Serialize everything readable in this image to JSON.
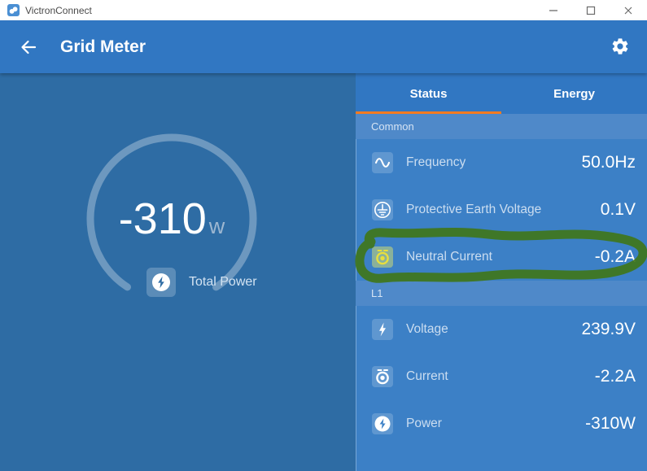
{
  "window": {
    "title": "VictronConnect",
    "controls": {
      "minimize": "minimize",
      "maximize": "maximize",
      "close": "close"
    }
  },
  "header": {
    "title": "Grid Meter"
  },
  "tabs": [
    {
      "label": "Status",
      "active": true
    },
    {
      "label": "Energy",
      "active": false
    }
  ],
  "gauge": {
    "value": "-310",
    "unit": "w",
    "label": "Total Power"
  },
  "sections": [
    {
      "title": "Common",
      "rows": [
        {
          "icon": "sine-wave-icon",
          "label": "Frequency",
          "value": "50.0Hz",
          "highlighted": false
        },
        {
          "icon": "protective-earth-icon",
          "label": "Protective Earth Voltage",
          "value": "0.1V",
          "highlighted": false
        },
        {
          "icon": "current-icon",
          "label": "Neutral Current",
          "value": "-0.2A",
          "highlighted": true
        }
      ]
    },
    {
      "title": "L1",
      "rows": [
        {
          "icon": "voltage-bolt-icon",
          "label": "Voltage",
          "value": "239.9V",
          "highlighted": false
        },
        {
          "icon": "current-icon",
          "label": "Current",
          "value": "-2.2A",
          "highlighted": false
        },
        {
          "icon": "power-bolt-icon",
          "label": "Power",
          "value": "-310W",
          "highlighted": false
        }
      ]
    }
  ],
  "annotation": {
    "type": "hand-drawn-marker-loop",
    "color": "#40761A",
    "target": "Neutral Current row"
  },
  "colors": {
    "accent_orange": "#F57B20",
    "header_blue": "#3177C2",
    "left_panel_blue": "#2E6CA4",
    "right_panel_blue": "#3C80C6",
    "section_bar_blue": "#4F89C9",
    "annotation_green": "#40761A"
  }
}
